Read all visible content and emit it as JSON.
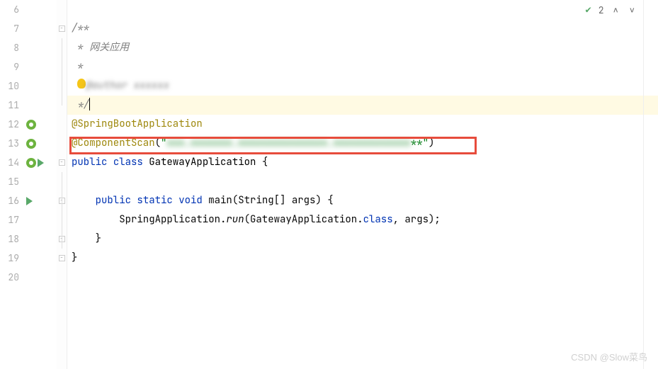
{
  "status": {
    "problem_count": "2",
    "check_symbol": "✔"
  },
  "gutter": {
    "lines": [
      "6",
      "7",
      "8",
      "9",
      "10",
      "11",
      "12",
      "13",
      "14",
      "15",
      "16",
      "17",
      "18",
      "19",
      "20"
    ]
  },
  "code": {
    "line7_docstart": "/**",
    "line8_star": " * ",
    "line8_text": "网关应用",
    "line9_star": " *",
    "line10_star": " * ",
    "line10_blur": "@author xxxxxx",
    "line11_end": " */",
    "line12_annotation": "@SpringBootApplication",
    "line13_annotation": "@ComponentScan",
    "line13_paren_open": "(",
    "line13_quote": "\"",
    "line13_scan_blur": "xxx.xxxxxxx.xxxxxxxxxxxxxxx.xxxxxxxxxxxxx",
    "line13_scan_end": "**\"",
    "line13_paren_close": ")",
    "line14_public": "public ",
    "line14_class": "class ",
    "line14_name": "GatewayApplication ",
    "line14_brace": "{",
    "line16_indent": "    ",
    "line16_public": "public ",
    "line16_static": "static ",
    "line16_void": "void ",
    "line16_main": "main",
    "line16_params": "(String[] args) {",
    "line17_indent": "        ",
    "line17_call": "SpringApplication.",
    "line17_run": "run",
    "line17_args_open": "(GatewayApplication.",
    "line17_classkw": "class",
    "line17_args_close": ", args);",
    "line18_close": "    }",
    "line19_close": "}"
  },
  "watermark": "CSDN @Slow菜鸟"
}
